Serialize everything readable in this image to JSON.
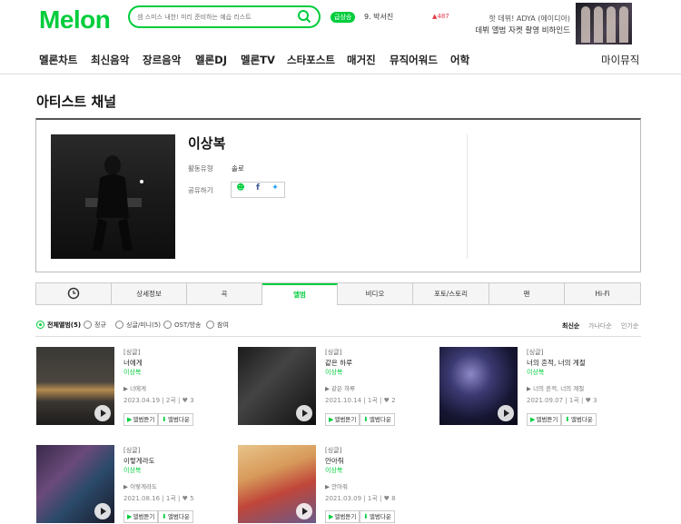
{
  "header": {
    "logo": "Melon",
    "search_placeholder": "셈 스미스 내한! 미리 준비하는 예습 리스트",
    "rank_badge": "급상승",
    "rank_item": "9. 박서진",
    "rank_change": "▲487",
    "promo_line1": "핫 데뷔! ADYA (에이디아)",
    "promo_line2": "데뷔 앨범 자켓 촬영 비하인드"
  },
  "nav": {
    "items": [
      "멜론차트",
      "최신음악",
      "장르음악",
      "멜론DJ",
      "멜론TV",
      "스타포스트",
      "매거진",
      "뮤직어워드",
      "어학"
    ],
    "my": "마이뮤직"
  },
  "page_title": "아티스트 채널",
  "artist": {
    "name": "이상복",
    "activity_label": "활동유형",
    "activity_value": "솔로",
    "share_label": "공유하기"
  },
  "tabs": [
    "상세정보",
    "곡",
    "앨범",
    "비디오",
    "포토/스토리",
    "팬",
    "Hi-Fi"
  ],
  "filters": {
    "options": [
      "전체앨범(5)",
      "정규",
      "싱글/미니(5)",
      "OST/방송",
      "참여"
    ],
    "sort": [
      "최신순",
      "가나다순",
      "인기순"
    ]
  },
  "albums": [
    {
      "type": "[싱글]",
      "title": "너에게",
      "artist": "이상복",
      "track": "너에게",
      "date": "2023.04.19",
      "count": "2곡",
      "likes": "3",
      "listen": "앨범듣기",
      "download": "앨범다운"
    },
    {
      "type": "[싱글]",
      "title": "같은 하루",
      "artist": "이상복",
      "track": "같은 하루",
      "date": "2021.10.14",
      "count": "1곡",
      "likes": "2",
      "listen": "앨범듣기",
      "download": "앨범다운"
    },
    {
      "type": "[싱글]",
      "title": "너의 흔적, 너의 계절",
      "artist": "이상복",
      "track": "너의 흔적, 너의 계절",
      "date": "2021.09.07",
      "count": "1곡",
      "likes": "3",
      "listen": "앨범듣기",
      "download": "앨범다운"
    },
    {
      "type": "[싱글]",
      "title": "이렇게라도",
      "artist": "이상복",
      "track": "이렇게라도",
      "date": "2021.08.16",
      "count": "1곡",
      "likes": "5",
      "listen": "앨범듣기",
      "download": "앨범다운"
    },
    {
      "type": "[싱글]",
      "title": "안아줘",
      "artist": "이상복",
      "track": "안아줘",
      "date": "2021.03.09",
      "count": "1곡",
      "likes": "8",
      "listen": "앨범듣기",
      "download": "앨범다운"
    }
  ],
  "colors": {
    "brand": "#00cd3c",
    "rank_up": "#e63946"
  }
}
